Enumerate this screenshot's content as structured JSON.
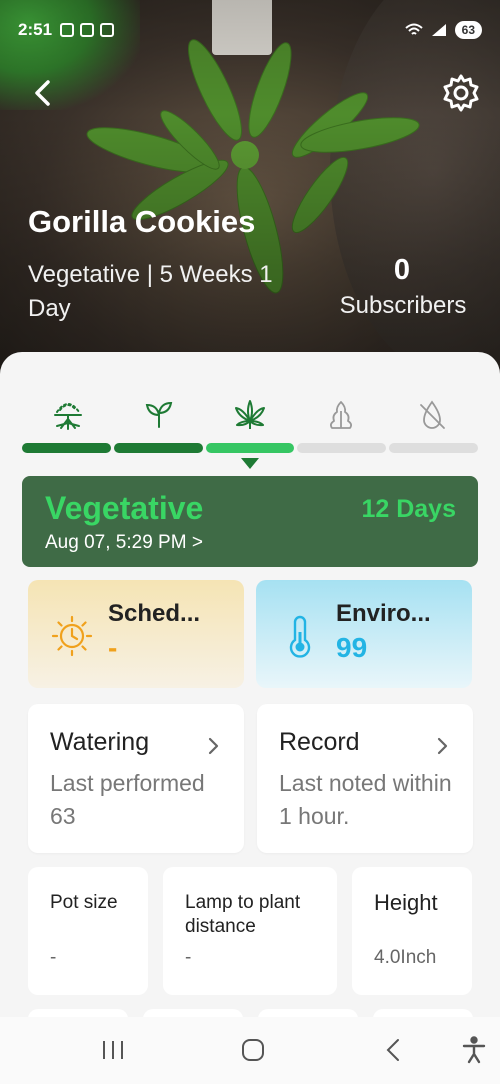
{
  "status_bar": {
    "time": "2:51",
    "battery": "63"
  },
  "header": {
    "back_icon": "chevron-left-icon",
    "settings_icon": "gear-icon",
    "plant_name": "Gorilla Cookies",
    "stage_summary": "Vegetative | 5 Weeks 1 Day",
    "subscribers_count": "0",
    "subscribers_label": "Subscribers"
  },
  "stages": {
    "icons": [
      "roots-icon",
      "seedling-icon",
      "cannabis-leaf-icon",
      "bud-icon",
      "harvest-icon"
    ],
    "progress": [
      "done",
      "done",
      "current",
      "todo",
      "todo"
    ]
  },
  "current_stage": {
    "name": "Vegetative",
    "days": "12 Days",
    "date": "Aug 07, 5:29 PM >"
  },
  "info_cards": {
    "schedule": {
      "title": "Sched...",
      "value": "-",
      "icon": "sun-clock-icon",
      "color": "#f0a11c"
    },
    "environment": {
      "title": "Enviro...",
      "value": "99",
      "icon": "thermometer-icon",
      "color": "#23b4e4"
    }
  },
  "actions": {
    "watering": {
      "title": "Watering",
      "desc": "Last performed 63"
    },
    "record": {
      "title": "Record",
      "desc": "Last noted within 1 hour."
    }
  },
  "metrics": {
    "pot_size": {
      "title": "Pot size",
      "value": "-"
    },
    "lamp_distance": {
      "title": "Lamp to plant distance",
      "value": "-"
    },
    "height": {
      "title": "Height",
      "value": "4.0Inch"
    }
  },
  "nav": [
    "recent-apps-icon",
    "home-icon",
    "back-icon",
    "accessibility-icon"
  ],
  "colors": {
    "accent": "#36c663",
    "dark_green": "#1e7a34",
    "stage_card": "#3f6b46"
  }
}
